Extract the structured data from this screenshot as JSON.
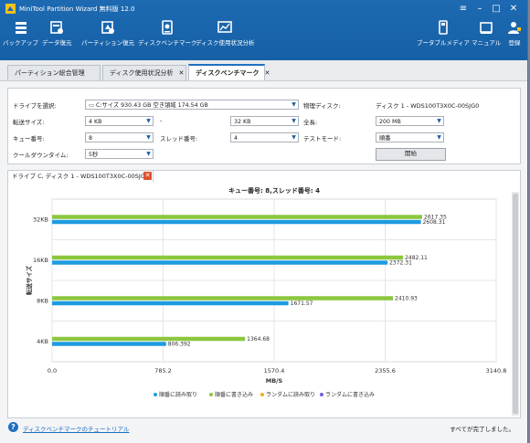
{
  "app": {
    "title": "MiniTool Partition Wizard 無料版 12.0"
  },
  "window_controls": {
    "menu": "≡",
    "minimize": "–",
    "maximize": "□",
    "close": "✕"
  },
  "toolbar": {
    "left": [
      {
        "label": "バックアップ",
        "icon": "backup-icon"
      },
      {
        "label": "データ復元",
        "icon": "data-recovery-icon"
      },
      {
        "label": "パーティション復元",
        "icon": "partition-recovery-icon"
      },
      {
        "label": "ディスクベンチマーク",
        "icon": "disk-benchmark-icon"
      },
      {
        "label": "ディスク使用状況分析",
        "icon": "space-analyzer-icon"
      }
    ],
    "right": [
      {
        "label": "ブータブルメディア",
        "icon": "bootable-media-icon"
      },
      {
        "label": "マニュアル",
        "icon": "manual-icon"
      },
      {
        "label": "登録",
        "icon": "register-icon"
      }
    ]
  },
  "tabs": [
    {
      "label": "パーティション総合管理",
      "closable": false
    },
    {
      "label": "ディスク使用状況分析",
      "closable": true
    },
    {
      "label": "ディスクベンチマーク",
      "closable": true,
      "active": true
    }
  ],
  "settings": {
    "drive_label": "ドライブを選択:",
    "drive_value": "C:サイズ 930.43 GB 空き領域 174.54 GB",
    "physical_disk_label": "物理ディスク:",
    "physical_disk_value": "ディスク 1 - WDS100T3X0C-00SJG0",
    "transfer_size_label": "転送サイズ:",
    "transfer_from": "4 KB",
    "range_sep": "-",
    "transfer_to": "32 KB",
    "total_length_label": "全長:",
    "total_length": "200 MB",
    "queue_label": "キュー番号:",
    "queue_value": "8",
    "thread_label": "スレッド番号:",
    "thread_value": "4",
    "test_mode_label": "テストモード:",
    "test_mode": "順番",
    "cooldown_label": "クールダウンタイム:",
    "cooldown": "5秒",
    "start_button": "開始"
  },
  "result_tab": {
    "label": "ドライブ C, ディスク 1 - WDS100T3X0C-00SJG0",
    "close": "✕"
  },
  "chart_data": {
    "type": "bar",
    "orientation": "horizontal",
    "title": "キュー番号: 8,スレッド番号: 4",
    "xlabel": "MB/S",
    "ylabel": "転送サイズ",
    "categories": [
      "32KB",
      "16KB",
      "8KB",
      "4KB"
    ],
    "xlim": [
      0,
      3140.8
    ],
    "xticks": [
      "0.0",
      "785.2",
      "1570.4",
      "2355.6",
      "3140.8"
    ],
    "grid": true,
    "series": [
      {
        "name": "順番に読み取り",
        "color": "#1e9be0",
        "values": [
          2608.31,
          2372.31,
          1671.57,
          806.392
        ],
        "labels": [
          "2608.31",
          "2372.31",
          "1671.57",
          "806.392"
        ]
      },
      {
        "name": "順番に書き込み",
        "color": "#8cc63f",
        "values": [
          2617.35,
          2482.11,
          2410.93,
          1364.68
        ],
        "labels": [
          "2617.35",
          "2482.11",
          "2410.93",
          "1364.68"
        ]
      },
      {
        "name": "ランダムに読み取り",
        "color": "#f5a623",
        "values": []
      },
      {
        "name": "ランダムに書き込み",
        "color": "#7b5bd6",
        "values": []
      }
    ],
    "legend_position": "bottom"
  },
  "footer": {
    "help_icon": "?",
    "help_link": "ディスクベンチマークのチュートリアル",
    "status": "すべてが完了しました。"
  }
}
